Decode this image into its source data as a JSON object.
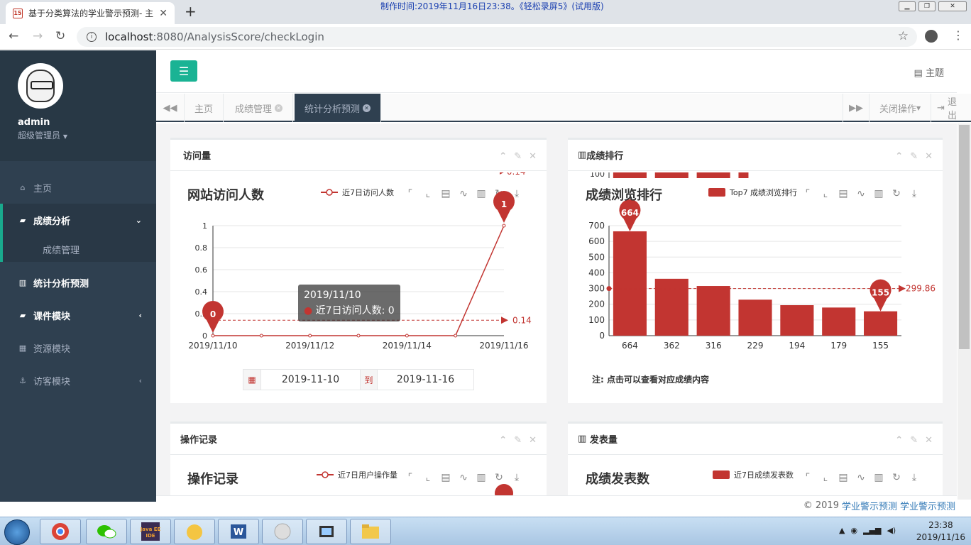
{
  "browser": {
    "tab_title": "基于分类算法的学业警示预测- 主",
    "tab_favicon": "15",
    "close": "✕",
    "new_tab": "+",
    "url_host": "localhost",
    "url_path": ":8080/AnalysisScore/checkLogin",
    "recorder_watermark": "制作时间:2019年11月16日23:38。《轻松录屏5》(试用版)"
  },
  "sidebar": {
    "user_name": "admin",
    "user_role": "超级管理员",
    "items": [
      {
        "label": "主页",
        "icon": "home-icon"
      },
      {
        "label": "成绩分析",
        "icon": "book-icon"
      },
      {
        "label": "统计分析预测",
        "icon": "bar-chart-icon"
      },
      {
        "label": "课件模块",
        "icon": "book-icon"
      },
      {
        "label": "资源模块",
        "icon": "grid-icon"
      },
      {
        "label": "访客模块",
        "icon": "anchor-icon"
      }
    ],
    "sub_items": [
      {
        "label": "成绩管理"
      }
    ]
  },
  "header": {
    "theme_label": "主题"
  },
  "tabs": {
    "items": [
      {
        "label": "主页"
      },
      {
        "label": "成绩管理"
      },
      {
        "label": "统计分析预测"
      }
    ],
    "close_ops": "关闭操作",
    "logout": "退出"
  },
  "panels": {
    "visits": {
      "header": "访问量",
      "title": "网站访问人数",
      "legend": "近7日访问人数"
    },
    "ranking": {
      "header": "成绩排行",
      "title": "成绩浏览排行",
      "legend": "Top7 成绩浏览排行",
      "note": "注: 点击可以查看对应成绩内容"
    },
    "ops": {
      "header": "操作记录",
      "title": "操作记录",
      "legend": "近7日用户操作量"
    },
    "publish": {
      "header": "发表量",
      "title": "成绩发表数",
      "legend": "近7日成绩发表数"
    }
  },
  "tooltip": {
    "date": "2019/11/10",
    "line": "近7日访问人数: 0"
  },
  "date_range": {
    "start": "2019-11-10",
    "to": "到",
    "end": "2019-11-16"
  },
  "footer": {
    "copy": "© 2019",
    "link1": "学业警示预测",
    "link2": "学业警示预测"
  },
  "taskbar": {
    "time": "23:38",
    "date": "2019/11/16"
  },
  "colors": {
    "accent": "#1ab394",
    "chart": "#c23531",
    "sidebar": "#2f4050"
  },
  "chart_data": [
    {
      "type": "line",
      "title": "网站访问人数",
      "x": [
        "2019/11/10",
        "2019/11/11",
        "2019/11/12",
        "2019/11/13",
        "2019/11/14",
        "2019/11/15",
        "2019/11/16"
      ],
      "xtick_labels": [
        "2019/11/10",
        "2019/11/12",
        "2019/11/14",
        "2019/11/16"
      ],
      "series": [
        {
          "name": "近7日访问人数",
          "values": [
            0,
            0,
            0,
            0,
            0,
            0,
            1
          ]
        }
      ],
      "ylim": [
        0,
        1
      ],
      "yticks": [
        "0",
        "0.2",
        "0.4",
        "0.6",
        "0.8",
        "1"
      ],
      "mark_points": {
        "min": "0",
        "max": "1"
      },
      "mark_line_label": "0.14",
      "mark_line_value": 0.14
    },
    {
      "type": "bar",
      "title": "成绩浏览排行",
      "categories": [
        "664",
        "362",
        "316",
        "229",
        "194",
        "179",
        "155"
      ],
      "series": [
        {
          "name": "Top7 成绩浏览排行",
          "values": [
            664,
            362,
            316,
            229,
            194,
            179,
            155
          ]
        }
      ],
      "ylim": [
        0,
        700
      ],
      "yticks": [
        "0",
        "100",
        "200",
        "300",
        "400",
        "500",
        "600",
        "700"
      ],
      "mark_points": {
        "max": "664",
        "min": "155"
      },
      "mark_line_label": "299.86",
      "mark_line_value": 299.86
    }
  ]
}
